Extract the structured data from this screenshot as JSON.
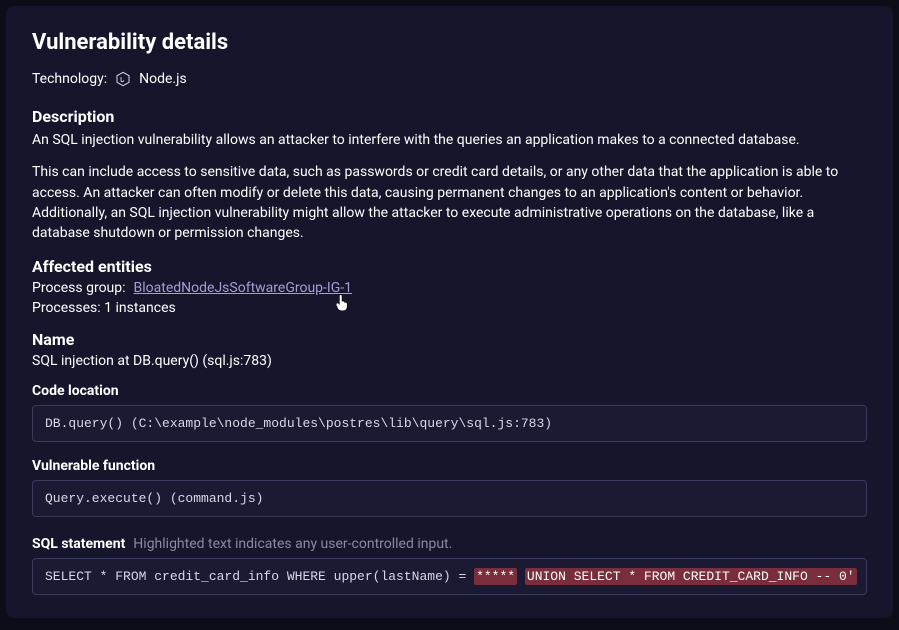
{
  "title": "Vulnerability details",
  "technology": {
    "label": "Technology:",
    "value": "Node.js"
  },
  "description": {
    "heading": "Description",
    "p1": "An SQL injection vulnerability allows an attacker to interfere with the queries an application makes to a connected database.",
    "p2": "This can include access to sensitive data, such as passwords or credit card details, or any other data that the application is able to access. An attacker can often modify or delete this data, causing permanent changes to an application's content or behavior. Additionally, an SQL injection vulnerability might allow the attacker to execute administrative operations on the database, like a database shutdown or permission changes."
  },
  "affected": {
    "heading": "Affected entities",
    "process_group_label": "Process group:",
    "process_group_link": "BloatedNodeJsSoftwareGroup-IG-1",
    "processes_text": "Processes: 1 instances"
  },
  "name": {
    "heading": "Name",
    "value": "SQL injection at DB.query() (sql.js:783)"
  },
  "code_location": {
    "label": "Code location",
    "value": "DB.query() (C:\\example\\node_modules\\postres\\lib\\query\\sql.js:783)"
  },
  "vulnerable_function": {
    "label": "Vulnerable function",
    "value": "Query.execute() (command.js)"
  },
  "sql": {
    "label": "SQL statement",
    "hint": "Highlighted text indicates any user-controlled input.",
    "prefix": "SELECT * FROM credit_card_info WHERE upper(lastName) = ",
    "hl1": "*****",
    "mid": " ",
    "hl2": "UNION SELECT * FROM CREDIT_CARD_INFO -- 0'"
  }
}
